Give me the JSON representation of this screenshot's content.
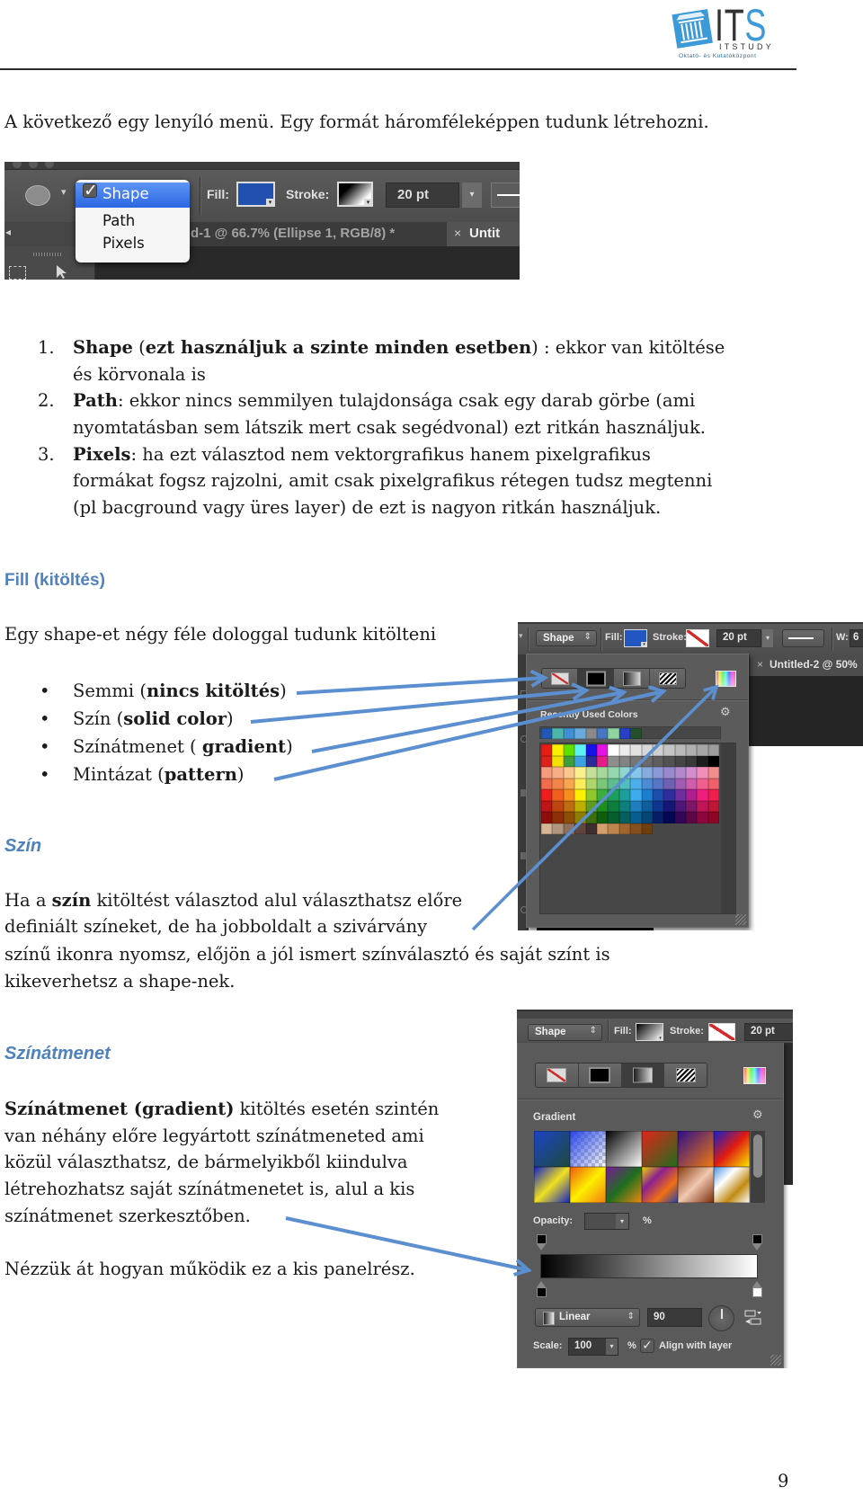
{
  "header": {
    "logo": {
      "letters_dark": "IT",
      "letter_accent": "S",
      "name": "ITSTUDY",
      "tagline": "Oktató- és Kutatóközpont"
    }
  },
  "intro": "A következő egy lenyíló menü. Egy formát háromféleképpen tudunk létrehozni.",
  "shape_mode_screenshot": {
    "mode_menu": {
      "check_mark": "✓",
      "items": [
        "Shape",
        "Path",
        "Pixels"
      ],
      "selected": "Shape"
    },
    "fill_label": "Fill:",
    "fill_color": "#2150b0",
    "stroke_label": "Stroke:",
    "stroke_width": "20 pt",
    "panel_collapse_glyph": "◂",
    "document_tab": "d-1 @ 66.7% (Ellipse 1, RGB/8) *",
    "second_tab_close": "×",
    "second_tab": "Untit"
  },
  "creation_modes": [
    {
      "number": "1.",
      "lines": [
        [
          "Shape",
          " (",
          "ezt használjuk a szinte minden esetben",
          ") : ekkor van kitöltése"
        ],
        [
          "és körvonala is"
        ]
      ]
    },
    {
      "number": "2.",
      "lines": [
        [
          "Path",
          ": ekkor nincs semmilyen tulajdonsága csak egy darab görbe (ami"
        ],
        [
          "nyomtatásban sem látszik mert csak segédvonal) ezt ritkán használjuk."
        ]
      ]
    },
    {
      "number": "3.",
      "lines": [
        [
          "Pixels",
          ": ha ezt választod nem vektorgrafikus hanem pixelgrafikus"
        ],
        [
          "formákat fogsz rajzolni, amit csak pixelgrafikus rétegen tudsz megtenni"
        ],
        [
          "(pl bacground vagy üres layer) de ezt is nagyon ritkán használjuk."
        ]
      ]
    }
  ],
  "fill_section": {
    "heading": "Fill (kitöltés)",
    "intro": "Egy shape-et négy féle dologgal tudunk kitölteni",
    "bullet": "•",
    "fill_types": [
      [
        "Semmi (",
        "nincs kitöltés",
        ")"
      ],
      [
        "Szín (",
        "solid color",
        ")"
      ],
      [
        "Színátmenet ( ",
        "gradient",
        ")"
      ],
      [
        "Mintázat (",
        "pattern",
        ")"
      ]
    ]
  },
  "color_section": {
    "heading": "Szín",
    "lines": [
      [
        "Ha a ",
        "szín",
        " kitöltést választod alul választhatsz előre"
      ],
      [
        "definiált színeket, de ha jobboldalt a szivárvány"
      ],
      [
        "színű ikonra nyomsz, előjön a jól ismert színválasztó és saját színt is"
      ],
      [
        "kikeverhetsz a shape-nek."
      ]
    ]
  },
  "gradient_section": {
    "heading": "Színátmenet",
    "lines": [
      [
        "Színátmenet (gradient)",
        " kitöltés esetén szintén"
      ],
      [
        "van néhány előre legyártott színátmeneted ami"
      ],
      [
        "közül választhatsz, de bármelyikből kiindulva"
      ],
      [
        "létrehozhatsz saját színátmenetet is, alul a kis"
      ],
      [
        "színátmenet szerkesztőben."
      ]
    ],
    "closing": "Nézzük át hogyan működik ez a kis panelrész."
  },
  "solid_fill_panel": {
    "menu_arrow": "▾",
    "mode_dropdown": "Shape",
    "updown_glyph": "⇕",
    "fill_label": "Fill:",
    "fill_color": "#2256c0",
    "stroke_label": "Stroke:",
    "stroke_width": "20 pt",
    "width_label": "W:",
    "width_value": "6",
    "document_tab_close": "×",
    "document_tab": "Untitled-2 @ 50%",
    "fill_type_buttons": [
      "no-fill",
      "solid-color",
      "gradient",
      "pattern"
    ],
    "selected_fill_type": "solid-color",
    "recent_label": "Recently Used Colors",
    "gear_glyph": "⚙",
    "recent_colors": [
      "#2456b4",
      "#4cb6ae",
      "#3f8fd4",
      "#6aaade",
      "#8a8a8a",
      "#4776c4",
      "#8fd3a0",
      "#2a3fc8",
      "#24502e"
    ],
    "swatch_rows": [
      [
        "#e61e14",
        "#f8f000",
        "#5de000",
        "#5cf2f2",
        "#1414e6",
        "#e414e4",
        "#ffffff",
        "#ececec",
        "#e2e2e2",
        "#d8d8d8",
        "#cecece",
        "#c4c4c4",
        "#bababa",
        "#b0b0b0",
        "#a6a6a6",
        "#9c9c9c"
      ],
      [
        "#e0221c",
        "#f2e204",
        "#3c9e40",
        "#3ea2e2",
        "#2c2c98",
        "#e41e88",
        "#8e8e8e",
        "#828282",
        "#767676",
        "#6a6a6a",
        "#5e5e5e",
        "#525252",
        "#464646",
        "#3a3a3a",
        "#1e1e1e",
        "#000000"
      ],
      [
        "#f49c7c",
        "#f7ae86",
        "#f9c68e",
        "#fcef8e",
        "#c6e09a",
        "#a6d89c",
        "#94d6ae",
        "#8ed6ce",
        "#86c6ea",
        "#86acde",
        "#8a98d8",
        "#9a88cc",
        "#b28acc",
        "#d28ece",
        "#f28ebc",
        "#f28e8e"
      ],
      [
        "#f06c4c",
        "#f2864a",
        "#f6a64c",
        "#fbec5c",
        "#aed66a",
        "#7cc67a",
        "#5cbe8c",
        "#4ebebe",
        "#4caeea",
        "#4c8cd6",
        "#5676c6",
        "#7060b4",
        "#a25cb4",
        "#d05cac",
        "#f0608e",
        "#f0606a"
      ],
      [
        "#ee1e1e",
        "#f05e1e",
        "#f68e1e",
        "#fbee00",
        "#8ec62c",
        "#3cae3c",
        "#1c9e5c",
        "#1c9e9e",
        "#3cacee",
        "#1c7ece",
        "#1c4eae",
        "#2e2e9e",
        "#6e2e9e",
        "#ae1e8e",
        "#ee1e7e",
        "#ee1e4e"
      ],
      [
        "#be1616",
        "#be460e",
        "#be6e0e",
        "#beae00",
        "#5e9e1e",
        "#1e8e1e",
        "#0e7e3e",
        "#0e7e7e",
        "#1e7ebe",
        "#0e5e9e",
        "#0e368e",
        "#161676",
        "#4e1676",
        "#7e1666",
        "#be1656",
        "#be1636"
      ],
      [
        "#8e0e0e",
        "#8e2e06",
        "#8e4e06",
        "#8e7e00",
        "#3e6e0e",
        "#0e5e0e",
        "#065e2e",
        "#065e5e",
        "#065e8e",
        "#064676",
        "#061e66",
        "#060656",
        "#360656",
        "#5e0646",
        "#8e063e",
        "#8e0626"
      ],
      [
        "#d6b696",
        "#b0967e",
        "#8e6e5e",
        "#5e463e",
        "#3e2e2e",
        "#d69e6e",
        "#be864e",
        "#9e662e",
        "#86501e",
        "#6e3e0e"
      ]
    ]
  },
  "gradient_panel": {
    "mode_dropdown": "Shape",
    "updown_glyph": "⇕",
    "fill_label": "Fill:",
    "stroke_label": "Stroke:",
    "stroke_width": "20 pt",
    "fill_type_buttons": [
      "no-fill",
      "solid-color",
      "gradient",
      "pattern"
    ],
    "selected_fill_type": "gradient",
    "gradient_label": "Gradient",
    "gear_glyph": "⚙",
    "presets": [
      {
        "stops": [
          "#1b44c8",
          "#1e4a3a"
        ]
      },
      {
        "stops": [
          "rgba(40,70,230,1)",
          "rgba(40,70,230,0)"
        ],
        "checker": true
      },
      {
        "stops": [
          "#000000",
          "#ffffff"
        ]
      },
      {
        "stops": [
          "#e4241a",
          "#1e6e1e"
        ]
      },
      {
        "stops": [
          "#2a0e8a",
          "#f07a10"
        ]
      },
      {
        "stops": [
          "#1020d0",
          "#e01c10",
          "#f8e800"
        ]
      },
      {
        "stops": [
          "#1020c8",
          "#f0e020",
          "#1020c8"
        ]
      },
      {
        "stops": [
          "#ee5a10",
          "#fcf000",
          "#f27a10"
        ]
      },
      {
        "stops": [
          "#7a1a9a",
          "#1e6e1e",
          "#f08a10"
        ]
      },
      {
        "stops": [
          "#f0d800",
          "#8a2090",
          "#f07010",
          "#2040b0"
        ]
      },
      {
        "stops": [
          "#8a3a10",
          "#f0c8b0",
          "#7a2a08"
        ]
      },
      {
        "stops": [
          "#4a90e0",
          "#ffffff",
          "#c08a10",
          "#ffffff"
        ]
      }
    ],
    "opacity_label": "Opacity:",
    "opacity_unit": "%",
    "gradient_stops": [
      "#000000",
      "#ffffff"
    ],
    "type_dropdown": "Linear",
    "angle": "90",
    "scale_label": "Scale:",
    "scale_value": "100",
    "scale_unit": "%",
    "align_with_layer": {
      "label": "Align with layer",
      "checked": true,
      "check_glyph": "✓"
    }
  },
  "colors": {
    "heading": "#4f81bd",
    "arrow": "#5b8fcf"
  },
  "page_number": "9"
}
